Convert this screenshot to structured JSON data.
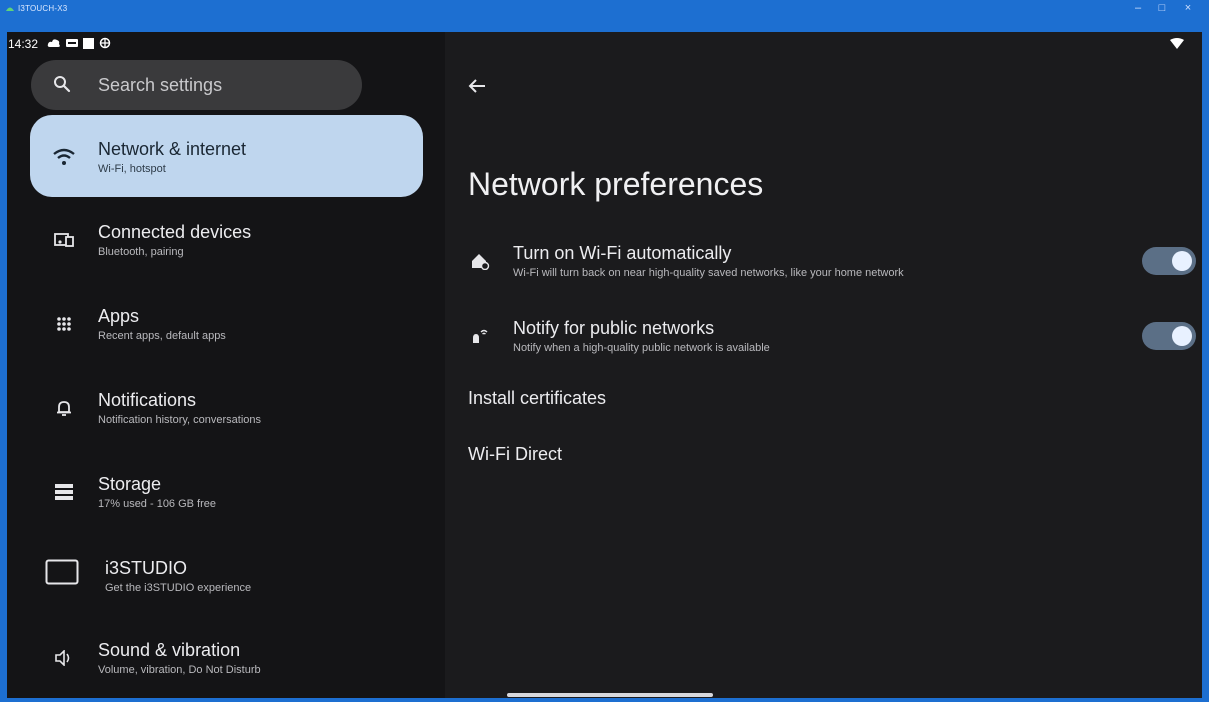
{
  "window": {
    "title": "I3TOUCH-X3",
    "minimize": "–",
    "maximize": "□",
    "close": "×",
    "accent": "#1d6fd1"
  },
  "statusbar": {
    "time": "14:32",
    "icons": [
      "cloud-icon",
      "dw-icon",
      "square-icon",
      "vpn-icon"
    ],
    "right_icon": "wifi-signal-icon"
  },
  "search": {
    "placeholder": "Search settings",
    "icon": "search-icon"
  },
  "sidebar": {
    "active_color": "#bfd6ee",
    "items": [
      {
        "label": "Network & internet",
        "sub": "Wi-Fi, hotspot",
        "icon": "wifi-icon",
        "active": true
      },
      {
        "label": "Connected devices",
        "sub": "Bluetooth, pairing",
        "icon": "devices-icon",
        "active": false
      },
      {
        "label": "Apps",
        "sub": "Recent apps, default apps",
        "icon": "apps-grid-icon",
        "active": false
      },
      {
        "label": "Notifications",
        "sub": "Notification history, conversations",
        "icon": "bell-icon",
        "active": false
      },
      {
        "label": "Storage",
        "sub": "17% used - 106 GB free",
        "icon": "storage-icon",
        "active": false
      },
      {
        "label": "i3STUDIO",
        "sub": "Get the i3STUDIO experience",
        "icon": "tablet-icon",
        "active": false
      },
      {
        "label": "Sound & vibration",
        "sub": "Volume, vibration, Do Not Disturb",
        "icon": "speaker-icon",
        "active": false
      }
    ]
  },
  "main": {
    "back_icon": "back-arrow-icon",
    "title": "Network preferences",
    "prefs": [
      {
        "title": "Turn on Wi-Fi automatically",
        "sub": "Wi-Fi will turn back on near high-quality saved networks, like your home network",
        "icon": "wifi-auto-icon",
        "toggle_on": true
      },
      {
        "title": "Notify for public networks",
        "sub": "Notify when a high-quality public network is available",
        "icon": "wifi-notify-icon",
        "toggle_on": true
      }
    ],
    "install_certificates": "Install certificates",
    "wifi_direct": "Wi-Fi Direct"
  }
}
